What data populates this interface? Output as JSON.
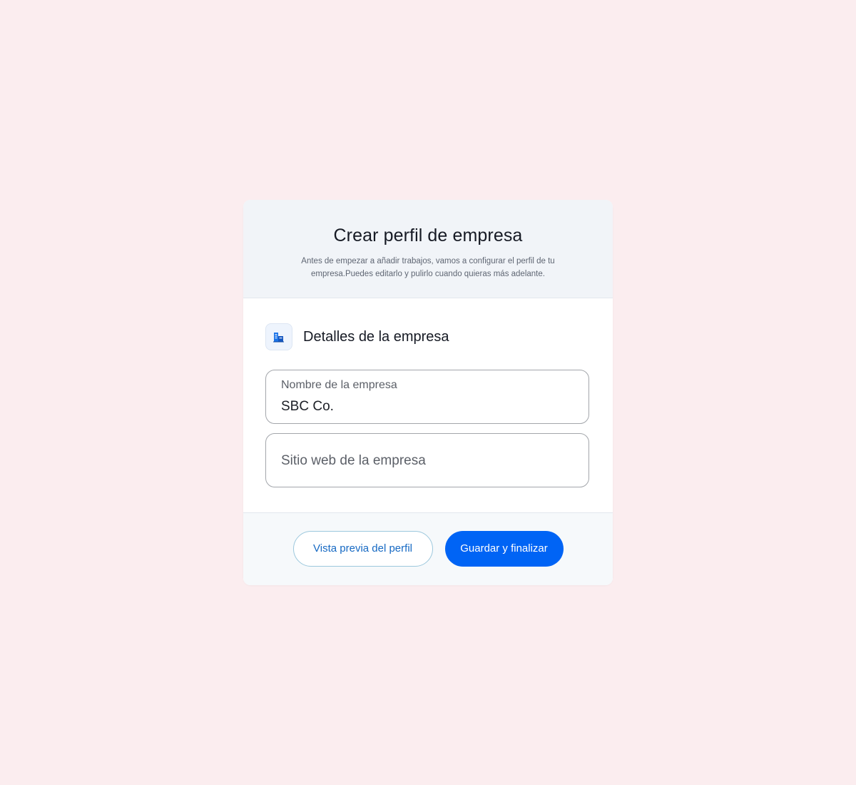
{
  "header": {
    "title": "Crear perfil de empresa",
    "subtitle": "Antes de empezar a añadir trabajos, vamos a configurar el perfil de tu empresa.Puedes editarlo y pulirlo cuando quieras más adelante."
  },
  "section": {
    "title": "Detalles de la empresa",
    "icon": "building-icon"
  },
  "fields": {
    "company_name": {
      "label": "Nombre de la empresa",
      "value": "SBC Co."
    },
    "company_website": {
      "placeholder": "Sitio web de la empresa",
      "value": ""
    }
  },
  "footer": {
    "preview_label": "Vista previa del perfil",
    "save_label": "Guardar y finalizar"
  },
  "colors": {
    "background": "#fbedef",
    "primary": "#0064f5",
    "secondary_text": "#1669c3",
    "icon_accent": "#1a73e8"
  }
}
